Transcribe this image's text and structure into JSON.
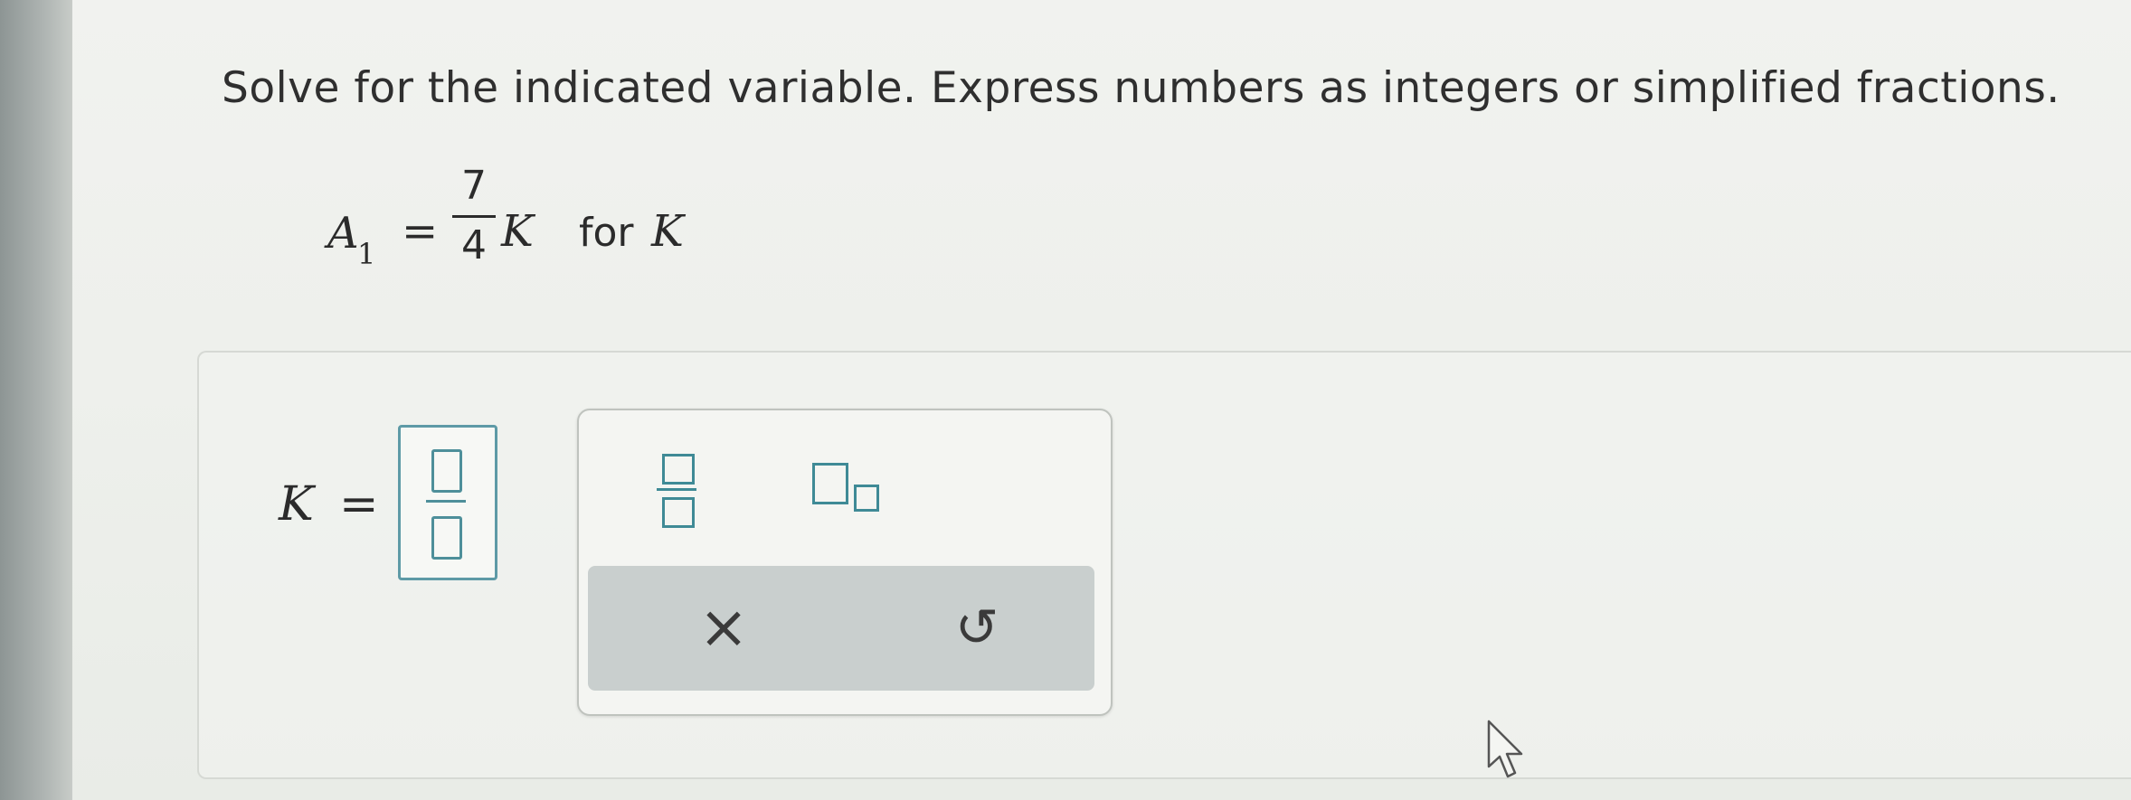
{
  "instructions": "Solve for the indicated variable. Express numbers as integers or simplified fractions.",
  "equation": {
    "lhs_var": "A",
    "lhs_sub": "1",
    "equals": "=",
    "numerator": "7",
    "denominator": "4",
    "rhs_var": "K",
    "for_text": "for",
    "solve_var": "K"
  },
  "answer": {
    "var": "K",
    "equals": "="
  },
  "keypad": {
    "buttons": [
      "fraction-icon",
      "subscript-icon",
      "clear-icon",
      "undo-icon"
    ],
    "clear_symbol": "×",
    "undo_symbol": "↺"
  },
  "colors": {
    "accent": "#3f8a96",
    "input_border": "#5e9aa6",
    "keypad_row": "#c9cfce"
  }
}
